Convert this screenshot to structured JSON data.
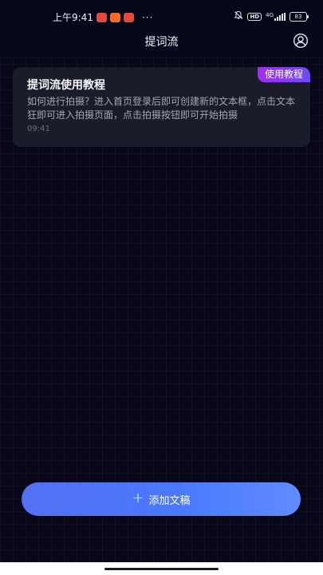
{
  "status_bar": {
    "time": "上午9:41",
    "app_icons": [
      {
        "name": "red-app-icon",
        "color": "#e8473b"
      },
      {
        "name": "orange-app-icon",
        "color": "#f26b2a"
      },
      {
        "name": "pink-app-icon",
        "color": "#e6483d"
      }
    ],
    "more": "···",
    "hd": "HD",
    "network": "4G",
    "battery": "83"
  },
  "header": {
    "title": "提词流"
  },
  "scripts": [
    {
      "badge": "使用教程",
      "title": "提词流使用教程",
      "description": "如何进行拍摄？进入首页登录后即可创建新的文本框，点击文本狂即可进入拍摄页面，点击拍摄按钮即可开始拍摄",
      "time": "09:41"
    }
  ],
  "footer": {
    "add_button_label": "添加文稿"
  },
  "colors": {
    "background": "#070719",
    "card": "#1b1c2a",
    "badge_gradient_start": "#a12cf0",
    "badge_gradient_end": "#6c4cf5",
    "button_gradient_start": "#5470f3",
    "button_gradient_end": "#5f8cff"
  }
}
